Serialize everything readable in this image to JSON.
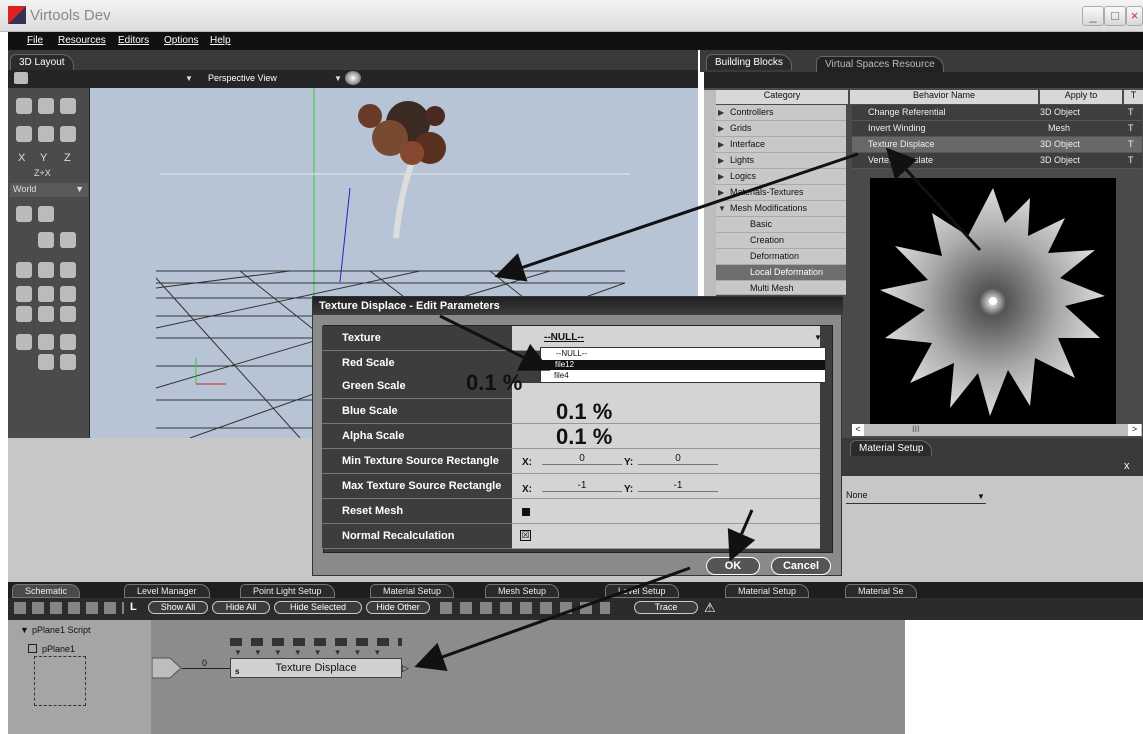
{
  "app": {
    "title": "Virtools Dev"
  },
  "menu": [
    "File",
    "Resources",
    "Editors",
    "Options",
    "Help"
  ],
  "left_tabs": {
    "layout": "3D Layout"
  },
  "viewport": {
    "camera": "Perspective View"
  },
  "toolbar": {
    "axis": "Z+X",
    "coord": "World",
    "x": "X",
    "y": "Y",
    "z": "Z"
  },
  "right_tabs": [
    "Building Blocks",
    "Virtual Spaces Resource"
  ],
  "bb": {
    "headers": [
      "Category",
      "Behavior Name",
      "Apply to",
      "T"
    ],
    "categories": [
      "Controllers",
      "Grids",
      "Interface",
      "Lights",
      "Logics",
      "Materials-Textures",
      "Mesh Modifications",
      "Basic",
      "Creation",
      "Deformation",
      "Local Deformation",
      "Multi Mesh"
    ],
    "behaviors": [
      {
        "name": "Change Referential",
        "apply": "3D Object",
        "t": "T"
      },
      {
        "name": "Invert Winding",
        "apply": "Mesh",
        "t": "T"
      },
      {
        "name": "Texture Displace",
        "apply": "3D Object",
        "t": "T"
      },
      {
        "name": "Vertex Translate",
        "apply": "3D Object",
        "t": "T"
      }
    ],
    "scroll_mark": "III"
  },
  "material_panel": {
    "tab": "Material Setup",
    "dropdown": "None",
    "close": "x"
  },
  "dialog": {
    "title": "Texture Displace - Edit Parameters",
    "params": [
      "Texture",
      "Red Scale",
      "Green Scale",
      "Blue Scale",
      "Alpha Scale",
      "Min Texture Source Rectangle",
      "Max Texture Source Rectangle",
      "Reset Mesh",
      "Normal Recalculation"
    ],
    "texture_value": "--NULL--",
    "texture_options": [
      "--NULL--",
      "file12",
      "file4"
    ],
    "green": "0.1 %",
    "blue": "0.1 %",
    "alpha": "0.1 %",
    "min_x": "0",
    "min_y": "0",
    "max_x": "-1",
    "max_y": "-1",
    "x_lbl": "X:",
    "y_lbl": "Y:",
    "ok": "OK",
    "cancel": "Cancel"
  },
  "schematic": {
    "tabs": [
      "Schematic",
      "Level Manager",
      "Point Light Setup",
      "Material Setup",
      "Mesh Setup",
      "Level Setup",
      "Material Setup",
      "Material Se"
    ],
    "buttons": [
      "Show All",
      "Hide All",
      "Hide Selected",
      "Hide Other",
      "Trace"
    ],
    "L": "L",
    "script": "pPlane1 Script",
    "object": "pPlane1",
    "block": "Texture Displace",
    "link_delay": "0",
    "port_s": "s"
  },
  "colors": {
    "accent_select": "#5e5e5e",
    "block_bg": "#d0d0d0",
    "arrow": "#111111"
  }
}
